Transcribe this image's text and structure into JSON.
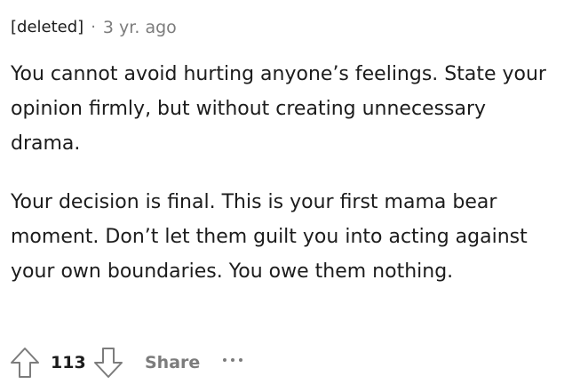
{
  "comment": {
    "author": "[deleted]",
    "separator": "·",
    "time": "3 yr. ago",
    "paragraphs": [
      "You cannot avoid hurting anyone’s feelings. State your opinion firmly, but without creating unnecessary drama.",
      "Your decision is final. This is your first mama bear moment. Don’t let them guilt you into acting against your own boundaries. You owe them nothing."
    ]
  },
  "actions": {
    "upvote_icon": "arrow-up-outline-icon",
    "score": "113",
    "downvote_icon": "arrow-down-outline-icon",
    "share_label": "Share",
    "more_icon": "ellipsis-icon"
  },
  "colors": {
    "text": "#1c1c1c",
    "muted": "#7c7c7c",
    "background": "#ffffff"
  }
}
